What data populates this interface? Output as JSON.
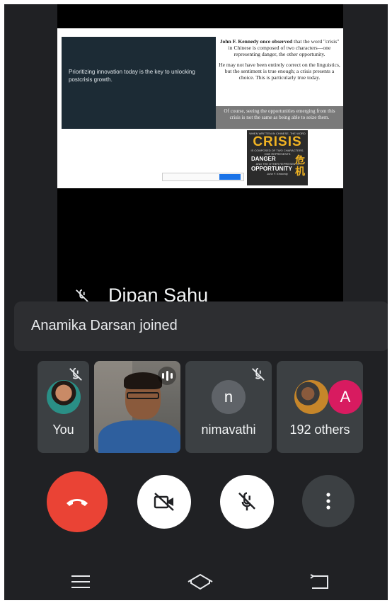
{
  "presentation": {
    "panel_text": "Prioritizing innovation today is the key to unlocking postcrisis growth.",
    "quote_bold": "John F. Kennedy once observed",
    "quote_rest": " that the word \"crisis\" in Chinese is composed of two characters—one representing danger, the other opportunity.",
    "para2": "He may not have been entirely correct on the linguistics, but the sentiment is true enough; a crisis presents a choice. This is particularly true today.",
    "grey_text": "Of course, seeing the opportunities emerging from this crisis is not the same as being able to seize them.",
    "book": {
      "line1": "WHEN WRITTEN IN CHINESE, THE WORD",
      "title": "CRISIS",
      "line2": "IS COMPOSED OF TWO CHARACTERS.",
      "line3": "ONE REPRESENTS",
      "word1": "DANGER",
      "line4": "AND THE OTHER REPRESENTS",
      "word2": "OPPORTUNITY",
      "kanji": "危\n机",
      "author": "John F. Kennedy"
    },
    "presenter_name": "Dipan Sahu"
  },
  "notification": {
    "text": "Anamika Darsan joined"
  },
  "participants": {
    "you_label": "You",
    "name2": "nimavathi",
    "name2_initial": "n",
    "others_label": "192 others",
    "others_initial": "A"
  },
  "colors": {
    "end_call": "#ea4335",
    "avatar_grey": "#5f6368",
    "avatar_pink": "#d81b60",
    "background": "#202124"
  },
  "icons": {
    "end_call": "phone-hangup-icon",
    "camera": "camera-off-icon",
    "mic": "mic-off-icon",
    "more": "more-vert-icon",
    "nav_menu": "menu-icon",
    "nav_home": "home-icon",
    "nav_back": "back-icon"
  }
}
